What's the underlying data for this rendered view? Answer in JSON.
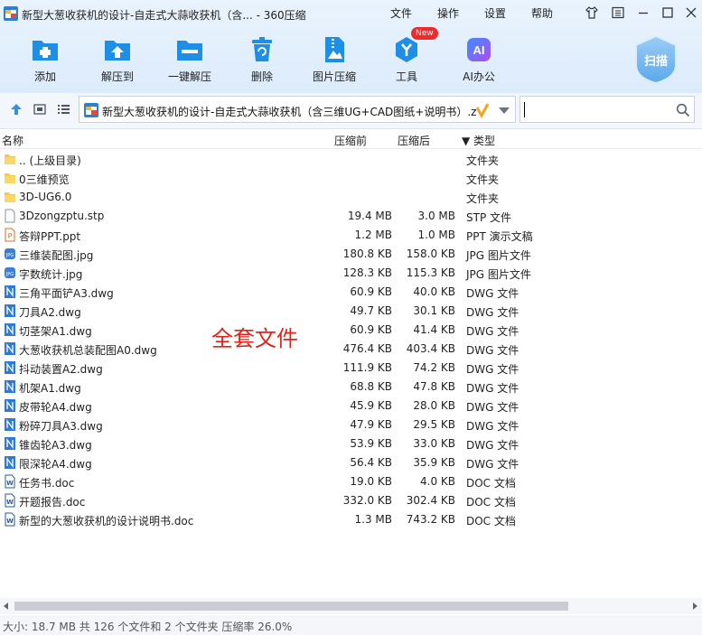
{
  "window": {
    "title": "新型大葱收获机的设计-自走式大蒜收获机（含... - 360压缩",
    "menus": [
      "文件",
      "操作",
      "设置",
      "帮助"
    ]
  },
  "toolbar": {
    "items": [
      {
        "label": "添加",
        "icon": "add-icon"
      },
      {
        "label": "解压到",
        "icon": "extract-to-icon"
      },
      {
        "label": "一键解压",
        "icon": "one-click-extract-icon"
      },
      {
        "label": "删除",
        "icon": "delete-icon"
      },
      {
        "label": "图片压缩",
        "icon": "image-compress-icon"
      },
      {
        "label": "工具",
        "icon": "tools-icon",
        "badge": "New"
      },
      {
        "label": "AI办公",
        "icon": "ai-office-icon",
        "glyph": "AI"
      }
    ],
    "scan_label": "扫描"
  },
  "address": {
    "path": "新型大葱收获机的设计-自走式大蒜收获机（含三维UG+CAD图纸+说明书）.z"
  },
  "search": {
    "placeholder": ""
  },
  "columns": {
    "name": "名称",
    "size": "压缩前",
    "packed": "压缩后",
    "type": "▼ 类型"
  },
  "files": [
    {
      "name": ".. (上级目录)",
      "size": "",
      "packed": "",
      "type": "文件夹",
      "kind": "folder"
    },
    {
      "name": "0三维预览",
      "size": "",
      "packed": "",
      "type": "文件夹",
      "kind": "folder"
    },
    {
      "name": "3D-UG6.0",
      "size": "",
      "packed": "",
      "type": "文件夹",
      "kind": "folder"
    },
    {
      "name": "3Dzongzptu.stp",
      "size": "19.4 MB",
      "packed": "3.0 MB",
      "type": "STP 文件",
      "kind": "blank"
    },
    {
      "name": "答辩PPT.ppt",
      "size": "1.2 MB",
      "packed": "1.0 MB",
      "type": "PPT 演示文稿",
      "kind": "ppt"
    },
    {
      "name": "三维装配图.jpg",
      "size": "180.8 KB",
      "packed": "158.0 KB",
      "type": "JPG 图片文件",
      "kind": "jpg"
    },
    {
      "name": "字数统计.jpg",
      "size": "128.3 KB",
      "packed": "115.3 KB",
      "type": "JPG 图片文件",
      "kind": "jpg"
    },
    {
      "name": "三角平面铲A3.dwg",
      "size": "60.9 KB",
      "packed": "40.0 KB",
      "type": "DWG 文件",
      "kind": "dwg"
    },
    {
      "name": "刀具A2.dwg",
      "size": "49.7 KB",
      "packed": "30.1 KB",
      "type": "DWG 文件",
      "kind": "dwg"
    },
    {
      "name": "切茎架A1.dwg",
      "size": "60.9 KB",
      "packed": "41.4 KB",
      "type": "DWG 文件",
      "kind": "dwg"
    },
    {
      "name": "大葱收获机总装配图A0.dwg",
      "size": "476.4 KB",
      "packed": "403.4 KB",
      "type": "DWG 文件",
      "kind": "dwg"
    },
    {
      "name": "抖动装置A2.dwg",
      "size": "111.9 KB",
      "packed": "74.2 KB",
      "type": "DWG 文件",
      "kind": "dwg"
    },
    {
      "name": "机架A1.dwg",
      "size": "68.8 KB",
      "packed": "47.8 KB",
      "type": "DWG 文件",
      "kind": "dwg"
    },
    {
      "name": "皮带轮A4.dwg",
      "size": "45.9 KB",
      "packed": "28.0 KB",
      "type": "DWG 文件",
      "kind": "dwg"
    },
    {
      "name": "粉碎刀具A3.dwg",
      "size": "47.9 KB",
      "packed": "29.5 KB",
      "type": "DWG 文件",
      "kind": "dwg"
    },
    {
      "name": "锥齿轮A3.dwg",
      "size": "53.9 KB",
      "packed": "33.0 KB",
      "type": "DWG 文件",
      "kind": "dwg"
    },
    {
      "name": "限深轮A4.dwg",
      "size": "56.4 KB",
      "packed": "35.9 KB",
      "type": "DWG 文件",
      "kind": "dwg"
    },
    {
      "name": "任务书.doc",
      "size": "19.0 KB",
      "packed": "4.0 KB",
      "type": "DOC 文档",
      "kind": "doc"
    },
    {
      "name": "开题报告.doc",
      "size": "332.0 KB",
      "packed": "302.4 KB",
      "type": "DOC 文档",
      "kind": "doc"
    },
    {
      "name": "新型的大葱收获机的设计说明书.doc",
      "size": "1.3 MB",
      "packed": "743.2 KB",
      "type": "DOC 文档",
      "kind": "doc"
    }
  ],
  "overlay_text": "全套文件",
  "status": "大小: 18.7 MB 共 126 个文件和 2 个文件夹 压缩率 26.0%",
  "colors": {
    "accent": "#1f8fe6",
    "overlay": "#e0231a",
    "folder": "#f6c94c",
    "dwg": "#2c7ad6",
    "doc": "#2b5797",
    "ppt": "#d86b2a"
  }
}
